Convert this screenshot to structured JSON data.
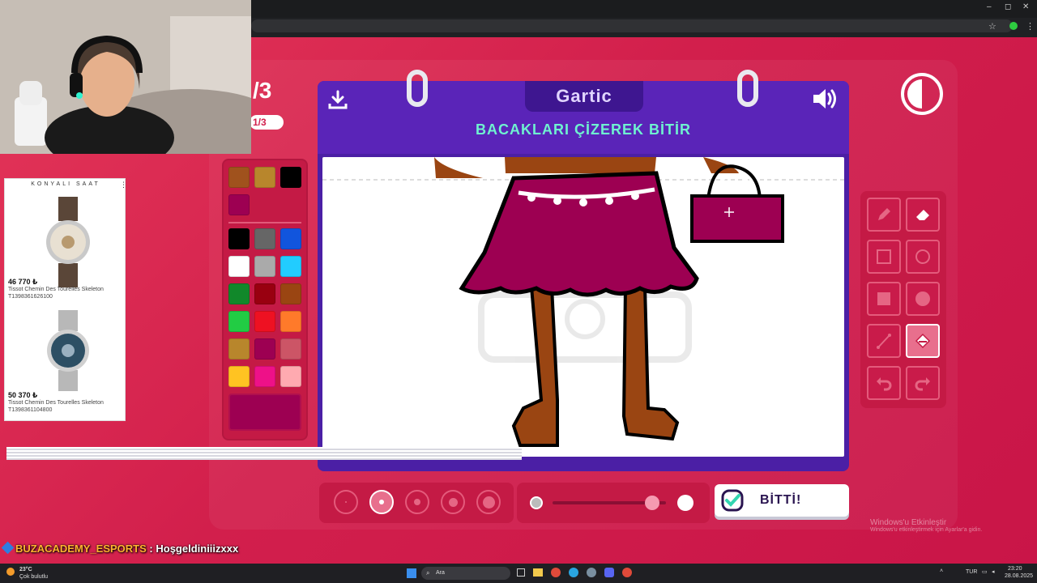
{
  "browser": {
    "minimize": "–",
    "restore": "◻",
    "close": "✕"
  },
  "game": {
    "logo": "Gartic",
    "instruction": "BACAKLARI ÇİZEREK BİTİR",
    "round": "/3",
    "round_pill": "1/3",
    "done_label": "BİTTİ!"
  },
  "palette": {
    "recent": [
      "#a0521d",
      "#b8862c",
      "#000000",
      "#9d0052"
    ],
    "colors": [
      "#000000",
      "#666666",
      "#1155dd",
      "#ffffff",
      "#aaaaaa",
      "#22ccff",
      "#11882a",
      "#990010",
      "#9a4512",
      "#22cc44",
      "#ee1122",
      "#ff7a2a",
      "#b8862c",
      "#9d0052",
      "#cc5566",
      "#ffc322",
      "#ee1188",
      "#ffaab0"
    ],
    "current": "#9d0052"
  },
  "tools": [
    "pencil-icon",
    "eraser-icon",
    "rect-outline-icon",
    "circle-outline-icon",
    "rect-fill-icon",
    "circle-fill-icon",
    "line-icon",
    "fill-bucket-icon",
    "undo-icon",
    "redo-icon"
  ],
  "active_tool": "fill-bucket-icon",
  "brush_sizes": {
    "selected_index": 1,
    "count": 5
  },
  "opacity_level": 0.88,
  "ad": {
    "brand": "KONYALI SAAT",
    "items": [
      {
        "price": "46 770 ₺",
        "name": "Tissot Chemin Des Tourelles Skeleton",
        "sku": "T1398361626100"
      },
      {
        "price": "50 370 ₺",
        "name": "Tissot Chemin Des Tourelles Skeleton",
        "sku": "T1398361104800"
      }
    ]
  },
  "chat": {
    "user": "BUZACADEMY_ESPORTS",
    "separator": " : ",
    "message": "Hoşgeldiniiizxxx"
  },
  "watermark": {
    "title": "Windows'u Etkinleştir",
    "subtitle": "Windows'u etkinleştirmek için Ayarlar'a gidin."
  },
  "taskbar": {
    "weather_temp": "23°C",
    "weather_desc": "Çok bulutlu",
    "search": "Ara",
    "lang": "TUR",
    "time": "23:20",
    "date": "28.08.2025"
  }
}
